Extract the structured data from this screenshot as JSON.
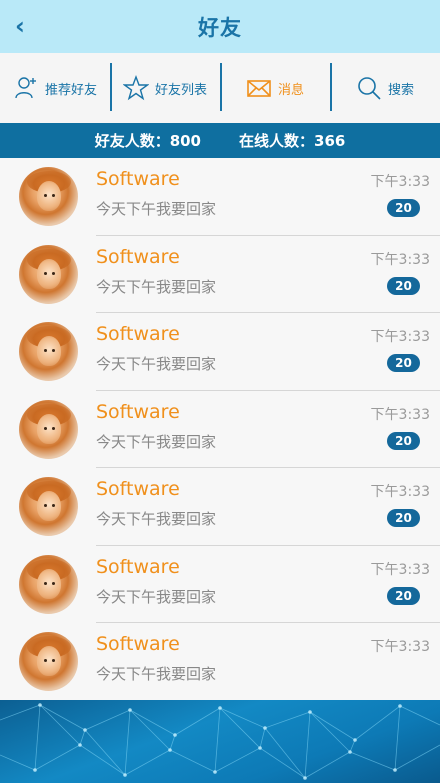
{
  "header": {
    "title": "好友",
    "back_icon": "chevron-left-icon"
  },
  "toolbar": [
    {
      "label": "推荐好友",
      "icon": "add-user-icon",
      "color": "#1a74a7"
    },
    {
      "label": "好友列表",
      "icon": "star-icon",
      "color": "#1a74a7"
    },
    {
      "label": "消息",
      "icon": "envelope-icon",
      "color": "#f0901c"
    },
    {
      "label": "搜索",
      "icon": "search-icon",
      "color": "#1a74a7"
    }
  ],
  "stats": {
    "friends": "好友人数：800",
    "online": "在线人数：366"
  },
  "friends": [
    {
      "name": "Software",
      "message": "今天下午我要回家",
      "time": "下午3:33",
      "badge": "20"
    },
    {
      "name": "Software",
      "message": "今天下午我要回家",
      "time": "下午3:33",
      "badge": "20"
    },
    {
      "name": "Software",
      "message": "今天下午我要回家",
      "time": "下午3:33",
      "badge": "20"
    },
    {
      "name": "Software",
      "message": "今天下午我要回家",
      "time": "下午3:33",
      "badge": "20"
    },
    {
      "name": "Software",
      "message": "今天下午我要回家",
      "time": "下午3:33",
      "badge": "20"
    },
    {
      "name": "Software",
      "message": "今天下午我要回家",
      "time": "下午3:33",
      "badge": "20"
    },
    {
      "name": "Software",
      "message": "今天下午我要回家",
      "time": "下午3:33",
      "badge": ""
    }
  ],
  "colors": {
    "header_bg": "#b9e9f8",
    "accent_blue": "#1a74a7",
    "accent_orange": "#f0901c",
    "stats_bg": "#0f6fa0",
    "badge_bg": "#14689b"
  }
}
